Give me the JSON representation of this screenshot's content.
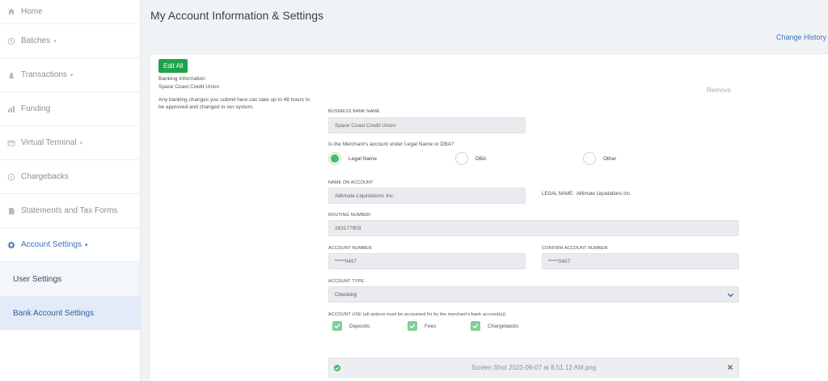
{
  "sidebar": {
    "items": [
      {
        "label": "Home",
        "icon": "home-icon"
      },
      {
        "label": "Batches",
        "icon": "batches-icon"
      },
      {
        "label": "Transactions",
        "icon": "transactions-icon"
      },
      {
        "label": "Funding",
        "icon": "funding-icon"
      },
      {
        "label": "Virtual Terminal",
        "icon": "terminal-icon"
      },
      {
        "label": "Chargebacks",
        "icon": "chargebacks-icon"
      },
      {
        "label": "Statements and Tax Forms",
        "icon": "document-icon"
      },
      {
        "label": "Account Settings",
        "icon": "gear-icon"
      }
    ],
    "sub_items": [
      {
        "label": "User Settings"
      },
      {
        "label": "Bank Account Settings"
      }
    ],
    "caret": "▾"
  },
  "header": {
    "title": "My Account Information & Settings",
    "change_history": "Change History"
  },
  "card": {
    "edit_all": "Edit All",
    "banking_info_heading": "Banking Information",
    "bank_name_summary": "Space Coast Credit Union",
    "notice": "Any banking changes you submit here can take up to 48 hours to be approved and changed in our system.",
    "remove": "Remove"
  },
  "form": {
    "business_bank_name_label": "BUSINESS BANK NAME",
    "business_bank_name_value": "Space Coast Credit Union",
    "account_under_question": "Is the Merchant's account under Legal Name or DBA?",
    "radios": {
      "legal_name": "Legal Name",
      "dba": "DBA",
      "other": "Other",
      "selected": "Legal Name"
    },
    "name_on_account_label": "NAME ON ACCOUNT",
    "name_on_account_value": "Alltimate Liquidations Inc.",
    "legal_name_label": "LEGAL NAME:",
    "legal_name_value": "Alltimate Liquidations Inc.",
    "routing_number_label": "ROUTING NUMBER",
    "routing_number_value": "263177903",
    "account_number_label": "ACCOUNT NUMBER",
    "account_number_value": "*****0497",
    "confirm_account_number_label": "CONFIRM ACCOUNT NUMBER",
    "confirm_account_number_value": "*****0497",
    "account_type_label": "ACCOUNT TYPE",
    "account_type_value": "Checking",
    "account_use_label": "ACCOUNT USE (all options must be accounted for by the merchant's bank account(s))",
    "account_use": {
      "deposits": "Deposits",
      "fees": "Fees",
      "chargebacks": "Chargebacks"
    },
    "attachment_name": "Screen Shot 2022-09-07 at 8.51.12 AM.png"
  },
  "colors": {
    "accent": "#3b73b9",
    "success": "#1ea34a",
    "check": "#7fcf98"
  }
}
